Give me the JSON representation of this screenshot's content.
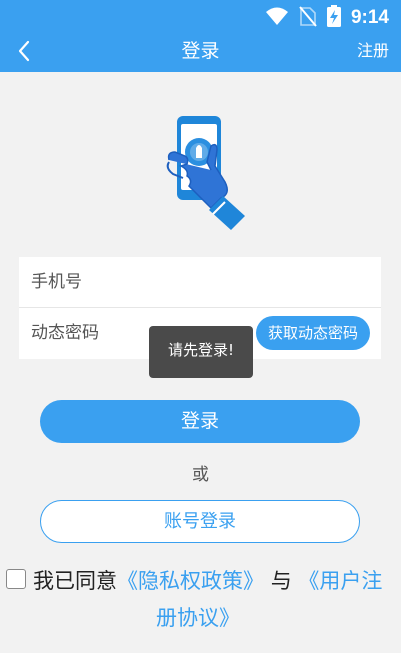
{
  "status_bar": {
    "time": "9:14",
    "icons": [
      "wifi-icon",
      "no-sim-icon",
      "battery-charging-icon"
    ]
  },
  "header": {
    "back_icon": "chevron-left-icon",
    "title": "登录",
    "register_label": "注册"
  },
  "hero": {
    "icon": "phone-hand-illustration"
  },
  "form": {
    "phone_placeholder": "手机号",
    "code_placeholder": "动态密码",
    "get_code_label": "获取动态密码"
  },
  "toast": {
    "text": "请先登录!"
  },
  "actions": {
    "login_label": "登录",
    "or_text": "或",
    "account_login_label": "账号登录"
  },
  "agreement": {
    "prefix": "我已同意",
    "privacy_link": "《隐私权政策》",
    "joiner": "与",
    "terms_link_part1": "《用户注",
    "terms_link_part2": "册协议》",
    "checked": false
  },
  "colors": {
    "primary": "#3aa0f0",
    "background": "#f2f2f2",
    "toast_bg": "#4a4a4a"
  }
}
